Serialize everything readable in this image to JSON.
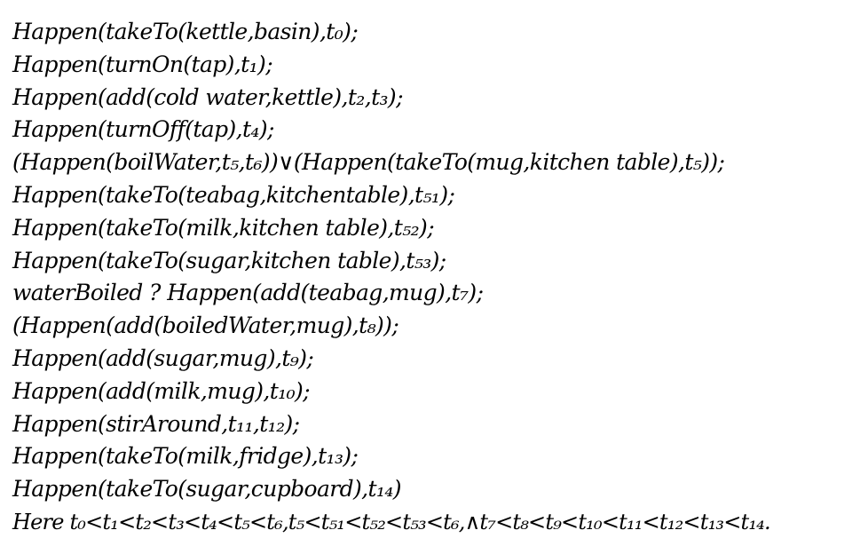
{
  "formula_lines": [
    "Happen(takeTo(kettle,basin),t₀);",
    "Happen(turnOn(tap),t₁);",
    "Happen(add(cold water,kettle),t₂,t₃);",
    "Happen(turnOff(tap),t₄);",
    "(Happen(boilWater,t₅,t₆))∨(Happen(takeTo(mug,kitchen table),t₅));",
    "Happen(takeTo(teabag,kitchentable),t₅₁);",
    "Happen(takeTo(milk,kitchen table),t₅₂);",
    "Happen(takeTo(sugar,kitchen table),t₅₃);",
    "waterBoiled ? Happen(add(teabag,mug),t₇);",
    "(Happen(add(boiledWater,mug),t₈));",
    "Happen(add(sugar,mug),t₉);",
    "Happen(add(milk,mug),t₁₀);",
    "Happen(stirAround,t₁₁,t₁₂);",
    "Happen(takeTo(milk,fridge),t₁₃);",
    "Happen(takeTo(sugar,cupboard),t₁₄)",
    "Here t₀<t₁<t₂<t₃<t₄<t₅<t₆,t₅<t₅₁<t₅₂<t₅₃<t₆,∧t₇<t₈<t₉<t₁₀<t₁₁<t₁₂<t₁₃<t₁₄."
  ]
}
